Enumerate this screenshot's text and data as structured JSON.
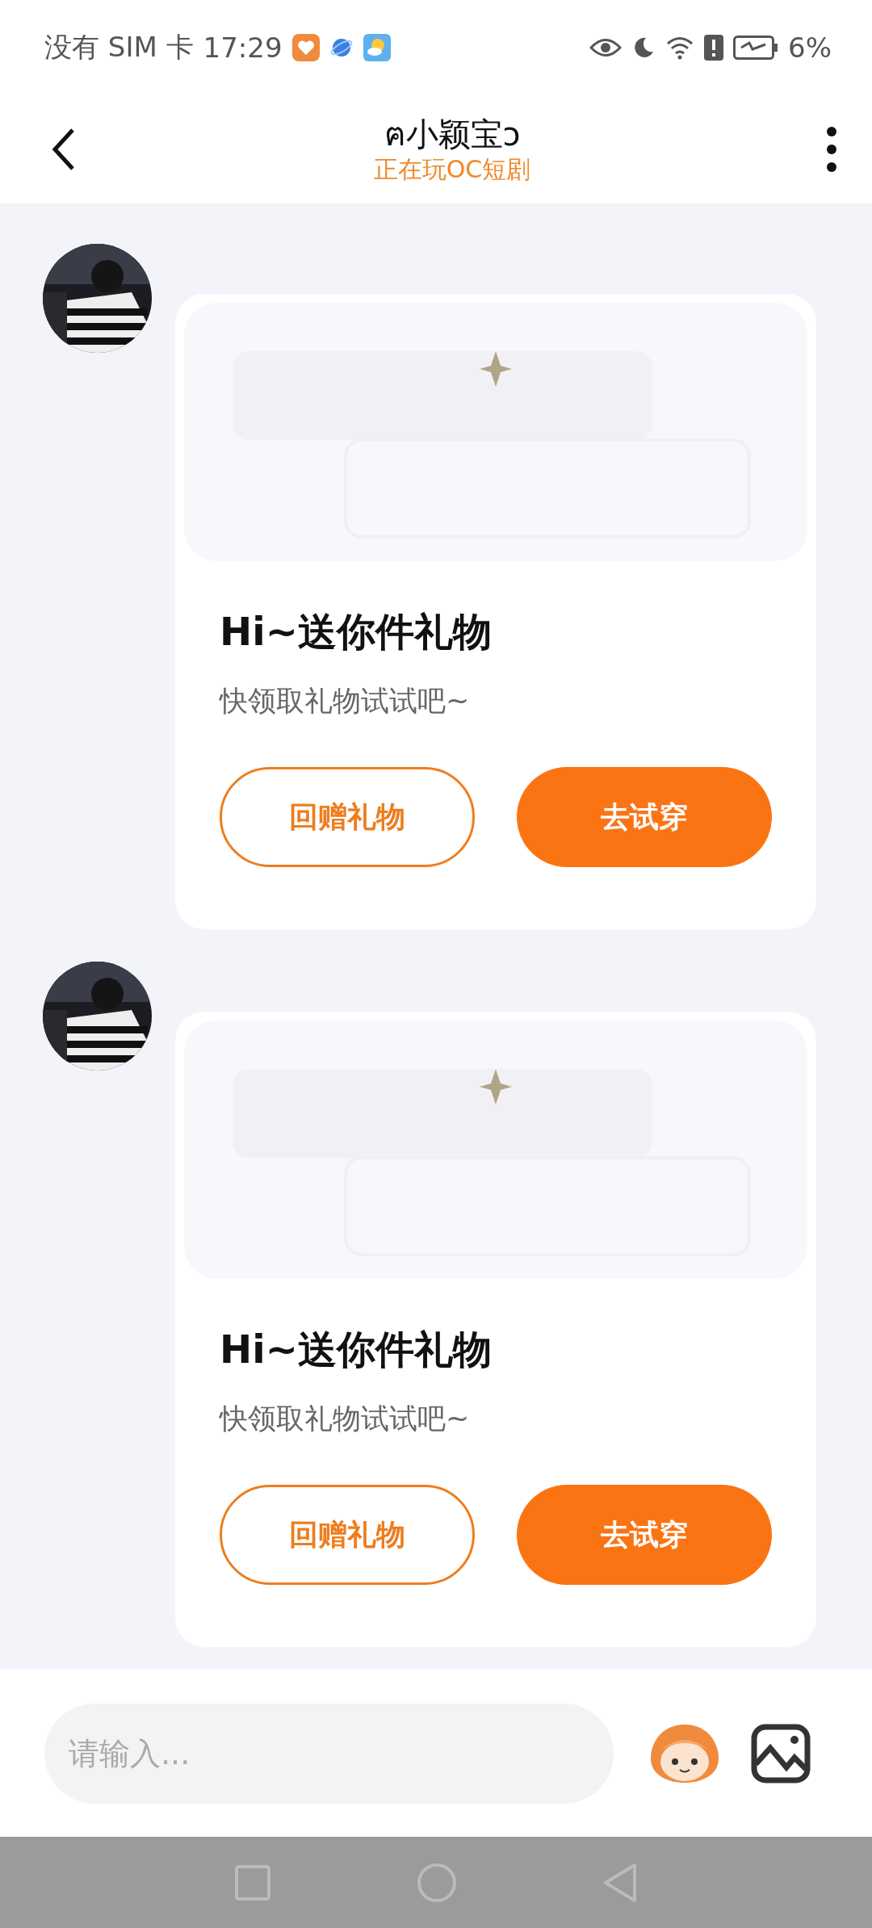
{
  "status_bar": {
    "carrier": "没有 SIM 卡",
    "time": "17:29",
    "battery": "6%"
  },
  "header": {
    "title": "ฅ小颖宝ɔ",
    "subtitle": "正在玩OC短剧"
  },
  "messages": [
    {
      "title": "Hi~送你件礼物",
      "subtitle": "快领取礼物试试吧~",
      "buttons": [
        {
          "label": "回赠礼物",
          "kind": "outline"
        },
        {
          "label": "去试穿",
          "kind": "filled"
        }
      ]
    },
    {
      "title": "Hi~送你件礼物",
      "subtitle": "快领取礼物试试吧~",
      "buttons": [
        {
          "label": "回赠礼物",
          "kind": "outline"
        },
        {
          "label": "去试穿",
          "kind": "filled"
        }
      ]
    }
  ],
  "composer": {
    "placeholder": "请输入..."
  }
}
